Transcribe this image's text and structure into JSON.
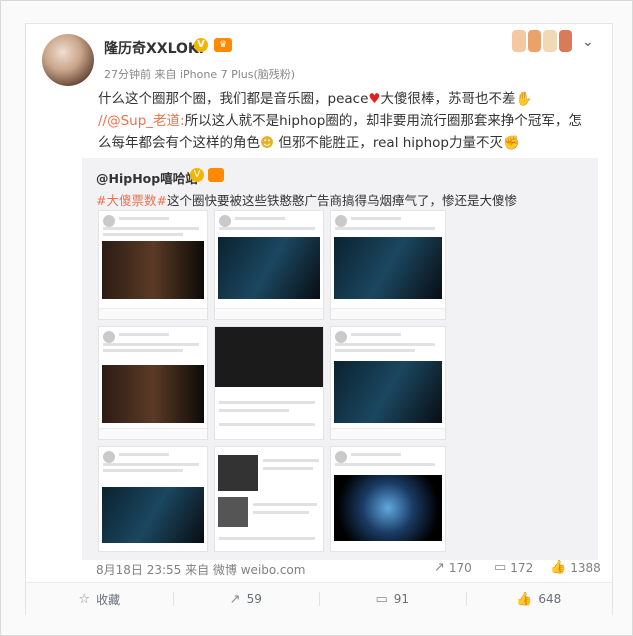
{
  "post": {
    "username": "隆历奇XXLOKI",
    "meta": "27分钟前 来自 iPhone 7 Plus(脑残粉)",
    "text_line1_a": "什么这个圈那个圈，我们都是音乐圈，peace",
    "text_line1_b": "大傻很棒，苏哥也不差",
    "text_line2_mention": "//@Sup_老道:",
    "text_line2_rest": "所以这人就不是hiphop圈的，却非要用流行圈那套来挣个冠军，怎",
    "text_line3": "么每年都会有个这样的角色",
    "text_line3_b": " 但邪不能胜正，real hiphop力量不灭"
  },
  "repost": {
    "username": "@HipHop嘻哈站",
    "tag": "#大傻票数#",
    "text": "这个圈快要被这些铁憨憨广告商搞得乌烟瘴气了，惨还是大傻惨"
  },
  "footer": {
    "time": "8月18日 23:55 来自 微博 weibo.com",
    "repost_count": "170",
    "comment_count": "172",
    "like_count": "1388"
  },
  "actions": {
    "favorite_label": "收藏",
    "share_count": "59",
    "comment_count": "91",
    "like_count": "648"
  },
  "icons": {
    "verified": "verified-badge-icon",
    "more": "chevron-down-icon",
    "repost": "repost-icon",
    "comment": "comment-icon",
    "like": "like-icon",
    "favorite": "star-icon",
    "share": "share-icon"
  },
  "colors": {
    "mention": "#eb7350",
    "heart": "#e0201c",
    "verified": "#f5b400"
  }
}
